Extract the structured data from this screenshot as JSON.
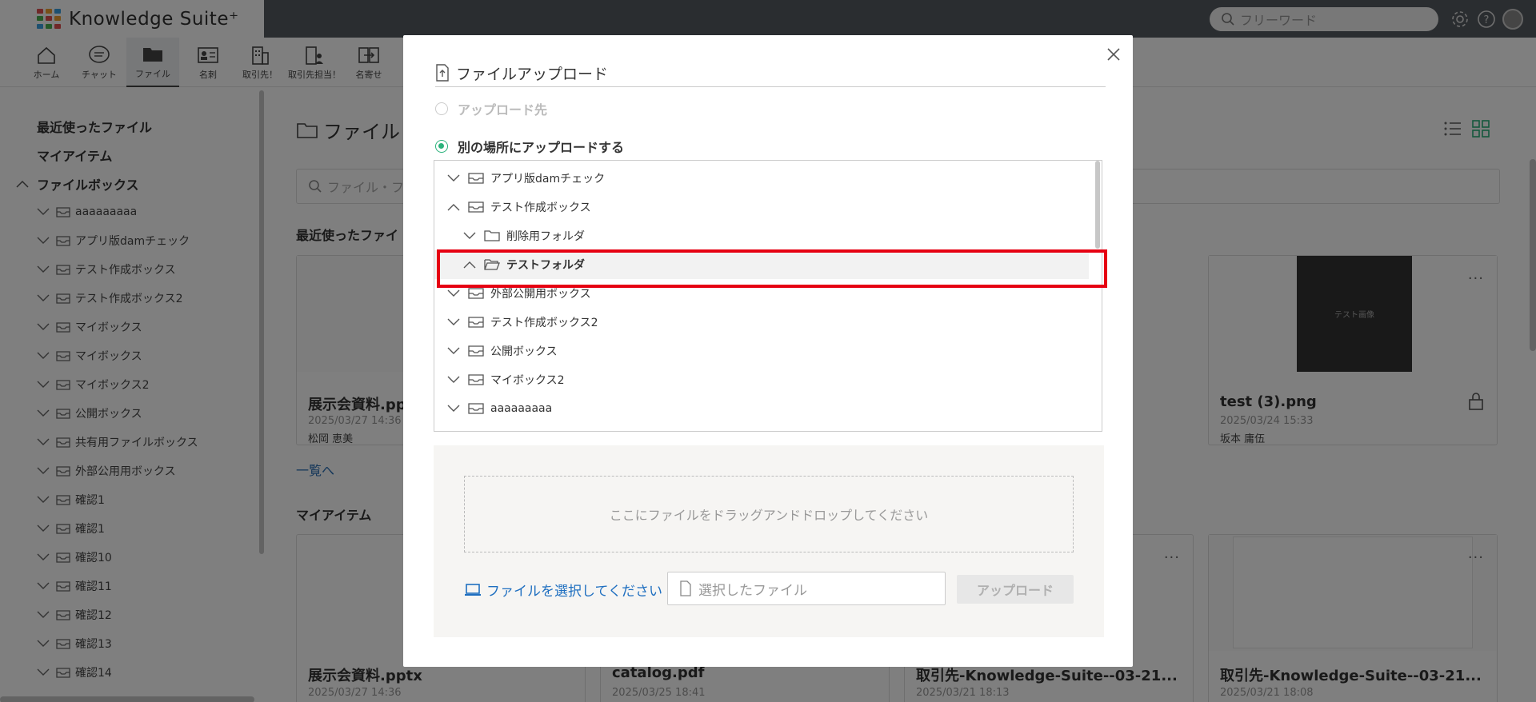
{
  "app": {
    "title": "Knowledge Suite⁺"
  },
  "header": {
    "search_placeholder": "フリーワード"
  },
  "nav": [
    {
      "label": "ホーム",
      "icon": "home-icon"
    },
    {
      "label": "チャット",
      "icon": "chat-icon"
    },
    {
      "label": "ファイル",
      "icon": "folder-icon",
      "active": true
    },
    {
      "label": "名刺",
      "icon": "business-card-icon"
    },
    {
      "label": "取引先！",
      "icon": "building-icon"
    },
    {
      "label": "取引先担当！",
      "icon": "contact-person-icon"
    },
    {
      "label": "名寄せ",
      "icon": "merge-icon"
    }
  ],
  "sidebar": {
    "recent": "最近使ったファイル",
    "my_items": "マイアイテム",
    "filebox": "ファイルボックス",
    "items": [
      "aaaaaaaaa",
      "アプリ版damチェック",
      "テスト作成ボックス",
      "テスト作成ボックス2",
      "マイボックス",
      "マイボックス",
      "マイボックス2",
      "公開ボックス",
      "共有用ファイルボックス",
      "外部公用用ボックス",
      "確認1",
      "確認1",
      "確認10",
      "確認11",
      "確認12",
      "確認13",
      "確認14"
    ]
  },
  "main": {
    "title": "ファイル",
    "search_placeholder": "ファイル・フ",
    "recent_section": "最近使ったファイ",
    "list_link": "一覧へ",
    "my_items_section": "マイアイテム",
    "recent_cards": [
      {
        "name": "展示会資料.pp",
        "date": "2025/03/27 14:36",
        "user": "松岡 恵美"
      },
      {
        "name": "test (3).png",
        "date": "2025/03/24 15:33",
        "user": "坂本 庸伍",
        "thumb_text": "テスト画像"
      }
    ],
    "my_cards": [
      {
        "name": "展示会資料.pptx",
        "date": "2025/03/27 14:36"
      },
      {
        "name": "catalog.pdf",
        "date": "2025/03/25 18:41"
      },
      {
        "name": "取引先-Knowledge-Suite--03-21...",
        "date": "2025/03/21 18:13"
      },
      {
        "name": "取引先-Knowledge-Suite--03-21...",
        "date": "2025/03/21 18:08"
      }
    ]
  },
  "modal": {
    "title": "ファイルアップロード",
    "option_dest": "アップロード先",
    "option_other": "別の場所にアップロードする",
    "tree": [
      {
        "label": "アプリ版damチェック",
        "level": 0,
        "expanded": false,
        "type": "box"
      },
      {
        "label": "テスト作成ボックス",
        "level": 0,
        "expanded": true,
        "type": "box"
      },
      {
        "label": "削除用フォルダ",
        "level": 1,
        "expanded": false,
        "type": "folder"
      },
      {
        "label": "テストフォルダ",
        "level": 1,
        "expanded": true,
        "type": "folder",
        "selected": true
      },
      {
        "label": "外部公開用ボックス",
        "level": 0,
        "expanded": false,
        "type": "box"
      },
      {
        "label": "テスト作成ボックス2",
        "level": 0,
        "expanded": false,
        "type": "box"
      },
      {
        "label": "公開ボックス",
        "level": 0,
        "expanded": false,
        "type": "box"
      },
      {
        "label": "マイボックス2",
        "level": 0,
        "expanded": false,
        "type": "box"
      },
      {
        "label": "aaaaaaaaa",
        "level": 0,
        "expanded": false,
        "type": "box"
      }
    ],
    "drop_text": "ここにファイルをドラッグアンドドロップしてください",
    "select_label": "ファイルを選択してください",
    "file_placeholder": "選択したファイル",
    "upload_label": "アップロード"
  },
  "colors": {
    "accent": "#2ab27b",
    "link": "#1f6fc0",
    "highlight": "#e60012"
  }
}
